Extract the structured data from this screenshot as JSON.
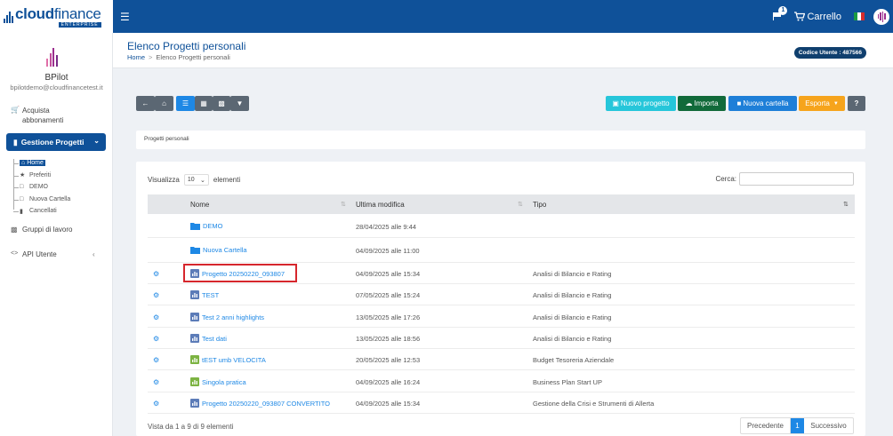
{
  "app": {
    "logo_main": "cloud",
    "logo_light": "finance",
    "logo_sub": "ENTERPRISE"
  },
  "topbar": {
    "notification_count": "1",
    "cart_label": "Carrello"
  },
  "sidebar": {
    "user_name": "BPilot",
    "user_email": "bpilotdemo@cloudfinancetest.it",
    "acquista": "Acquista abbonamenti",
    "gestione": "Gestione Progetti",
    "tree": [
      "Home",
      "Preferiti",
      "DEMO",
      "Nuova Cartella",
      "Cancellati"
    ],
    "gruppi": "Gruppi di lavoro",
    "api": "API Utente"
  },
  "header": {
    "title": "Elenco Progetti personali",
    "crumb_home": "Home",
    "crumb_current": "Elenco Progetti personali",
    "user_code": "Codice Utente : 487566"
  },
  "toolbar": {
    "nuovo": "Nuovo progetto",
    "importa": "Importa",
    "cartella": "Nuova cartella",
    "esporta": "Esporta"
  },
  "section": {
    "label": "Progetti personali"
  },
  "table": {
    "show_prefix": "Visualizza",
    "show_value": "10",
    "show_suffix": "elementi",
    "search_label": "Cerca:",
    "headers": {
      "name": "Nome",
      "modified": "Ultima modifica",
      "type": "Tipo"
    },
    "rows": [
      {
        "name": "DEMO",
        "modified": "28/04/2025 alle 9:44",
        "type": ""
      },
      {
        "name": "Nuova Cartella",
        "modified": "04/09/2025 alle 11:00",
        "type": ""
      },
      {
        "name": "Progetto 20250220_093807",
        "modified": "04/09/2025 alle 15:34",
        "type": "Analisi di Bilancio e Rating"
      },
      {
        "name": "TEST",
        "modified": "07/05/2025 alle 15:24",
        "type": "Analisi di Bilancio e Rating"
      },
      {
        "name": "Test 2 anni highlights",
        "modified": "13/05/2025 alle 17:26",
        "type": "Analisi di Bilancio e Rating"
      },
      {
        "name": "Test dati",
        "modified": "13/05/2025 alle 18:56",
        "type": "Analisi di Bilancio e Rating"
      },
      {
        "name": "tEST umb VELOCITA",
        "modified": "20/05/2025 alle 12:53",
        "type": "Budget Tesoreria Aziendale"
      },
      {
        "name": "Singola pratica",
        "modified": "04/09/2025 alle 16:24",
        "type": "Business Plan Start UP"
      },
      {
        "name": "Progetto 20250220_093807 CONVERTITO",
        "modified": "04/09/2025 alle 15:34",
        "type": "Gestione della Crisi e Strumenti di Allerta"
      }
    ],
    "info": "Vista da 1 a 9 di 9 elementi",
    "prev": "Precedente",
    "page": "1",
    "next": "Successivo"
  }
}
